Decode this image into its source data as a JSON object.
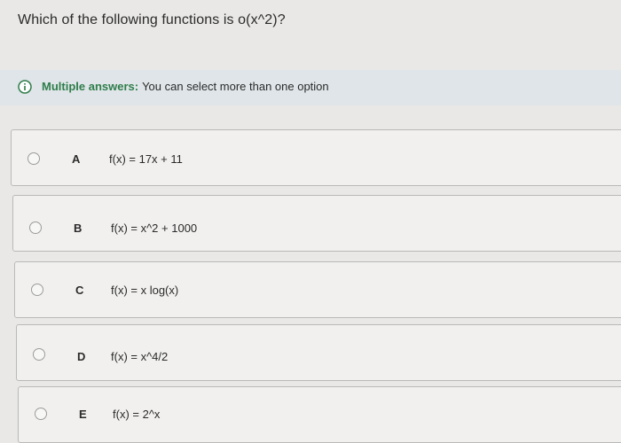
{
  "question": {
    "text": "Which of the following functions is o(x^2)?"
  },
  "info": {
    "icon": "info-icon",
    "label": "Multiple answers:",
    "message": "You can select more than one option"
  },
  "colors": {
    "info_label": "#2f7d4b",
    "info_bar_bg": "#dfe5e8",
    "page_bg": "#e9e8e6"
  },
  "options": [
    {
      "letter": "A",
      "formula": "f(x) = 17x + 11"
    },
    {
      "letter": "B",
      "formula": "f(x) = x^2 + 1000"
    },
    {
      "letter": "C",
      "formula": "f(x) = x log(x)"
    },
    {
      "letter": "D",
      "formula": "f(x) = x^4/2"
    },
    {
      "letter": "E",
      "formula": "f(x) = 2^x"
    }
  ]
}
